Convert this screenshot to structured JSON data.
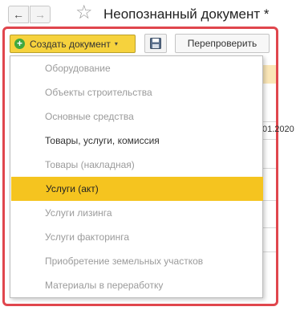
{
  "window": {
    "title": "Неопознанный документ *",
    "back_symbol": "←",
    "forward_symbol": "→",
    "star_symbol": "☆"
  },
  "toolbar": {
    "create_label": "Создать документ",
    "create_icon": "plus-circle-icon",
    "caret_symbol": "▾",
    "save_icon": "floppy-disk-icon",
    "recheck_label": "Перепроверить"
  },
  "background": {
    "date_fragment": "01.2020"
  },
  "menu": {
    "items": [
      {
        "label": "Оборудование",
        "enabled": false,
        "selected": false
      },
      {
        "label": "Объекты строительства",
        "enabled": false,
        "selected": false
      },
      {
        "label": "Основные средства",
        "enabled": false,
        "selected": false
      },
      {
        "label": "Товары, услуги, комиссия",
        "enabled": true,
        "selected": false
      },
      {
        "label": "Товары (накладная)",
        "enabled": false,
        "selected": false
      },
      {
        "label": "Услуги (акт)",
        "enabled": true,
        "selected": true
      },
      {
        "label": "Услуги лизинга",
        "enabled": false,
        "selected": false
      },
      {
        "label": "Услуги факторинга",
        "enabled": false,
        "selected": false
      },
      {
        "label": "Приобретение земельных участков",
        "enabled": false,
        "selected": false
      },
      {
        "label": "Материалы в переработку",
        "enabled": false,
        "selected": false
      }
    ]
  },
  "colors": {
    "accent_yellow": "#f5c41f",
    "highlight_frame": "#e0464d",
    "disabled_text": "#9b9b9b",
    "header_tint": "#fae6b7"
  }
}
